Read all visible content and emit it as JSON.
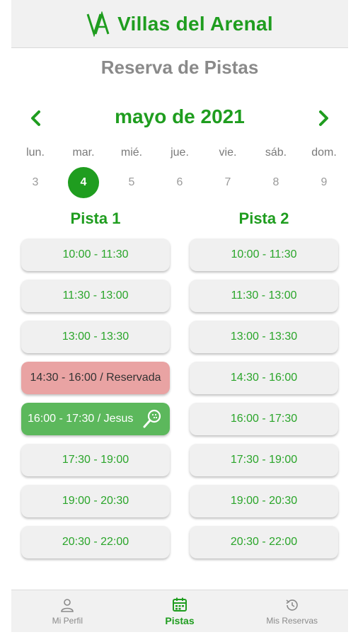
{
  "header": {
    "brand": "Villas del Arenal",
    "logo_text": "VA",
    "logo_icon": "va-monogram-logo"
  },
  "page": {
    "title": "Reserva de Pistas"
  },
  "calendar": {
    "month": "mayo de 2021",
    "prev_icon": "chevron-left-icon",
    "next_icon": "chevron-right-icon",
    "weekdays": [
      "lun.",
      "mar.",
      "mié.",
      "jue.",
      "vie.",
      "sáb.",
      "dom."
    ],
    "days": [
      "3",
      "4",
      "5",
      "6",
      "7",
      "8",
      "9"
    ],
    "selected_day": "4"
  },
  "courts": [
    {
      "name": "Pista 1",
      "slots": [
        {
          "label": "10:00 - 11:30",
          "status": "free"
        },
        {
          "label": "11:30 - 13:00",
          "status": "free"
        },
        {
          "label": "13:00 - 13:30",
          "status": "free"
        },
        {
          "label": "14:30 - 16:00 / Reservada",
          "status": "reserved"
        },
        {
          "label": "16:00 - 17:30 / Jesus",
          "status": "mine",
          "icon": "padel-racket-icon"
        },
        {
          "label": "17:30 - 19:00",
          "status": "free"
        },
        {
          "label": "19:00 - 20:30",
          "status": "free"
        },
        {
          "label": "20:30 - 22:00",
          "status": "free"
        }
      ]
    },
    {
      "name": "Pista 2",
      "slots": [
        {
          "label": "10:00 - 11:30",
          "status": "free"
        },
        {
          "label": "11:30 - 13:00",
          "status": "free"
        },
        {
          "label": "13:00 - 13:30",
          "status": "free"
        },
        {
          "label": "14:30 - 16:00",
          "status": "free"
        },
        {
          "label": "16:00 - 17:30",
          "status": "free"
        },
        {
          "label": "17:30 - 19:00",
          "status": "free"
        },
        {
          "label": "19:00 - 20:30",
          "status": "free"
        },
        {
          "label": "20:30 - 22:00",
          "status": "free"
        }
      ]
    }
  ],
  "bottom_nav": {
    "items": [
      {
        "label": "Mi Perfil",
        "icon": "user-icon"
      },
      {
        "label": "Pistas",
        "icon": "calendar-icon",
        "active": true
      },
      {
        "label": "Mis Reservas",
        "icon": "history-icon"
      }
    ]
  },
  "colors": {
    "accent": "#1f9d1f",
    "reserved": "#e9a3a3",
    "mine": "#5cb85c",
    "header_bg": "#f1f1f1"
  }
}
